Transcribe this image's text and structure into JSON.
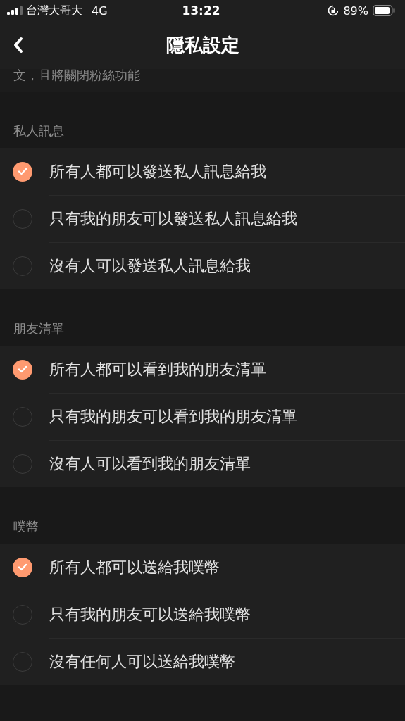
{
  "status_bar": {
    "carrier": "台灣大哥大",
    "network": "4G",
    "time": "13:22",
    "battery": "89%"
  },
  "nav": {
    "title": "隱私設定"
  },
  "note": "文，且將關閉粉絲功能",
  "sections": [
    {
      "title": "私人訊息",
      "options": [
        {
          "label": "所有人都可以發送私人訊息給我",
          "selected": true
        },
        {
          "label": "只有我的朋友可以發送私人訊息給我",
          "selected": false
        },
        {
          "label": "沒有人可以發送私人訊息給我",
          "selected": false
        }
      ]
    },
    {
      "title": "朋友清單",
      "options": [
        {
          "label": "所有人都可以看到我的朋友清單",
          "selected": true
        },
        {
          "label": "只有我的朋友可以看到我的朋友清單",
          "selected": false
        },
        {
          "label": "沒有人可以看到我的朋友清單",
          "selected": false
        }
      ]
    },
    {
      "title": "噗幣",
      "options": [
        {
          "label": "所有人都可以送給我噗幣",
          "selected": true
        },
        {
          "label": "只有我的朋友可以送給我噗幣",
          "selected": false
        },
        {
          "label": "沒有任何人可以送給我噗幣",
          "selected": false
        }
      ]
    }
  ]
}
